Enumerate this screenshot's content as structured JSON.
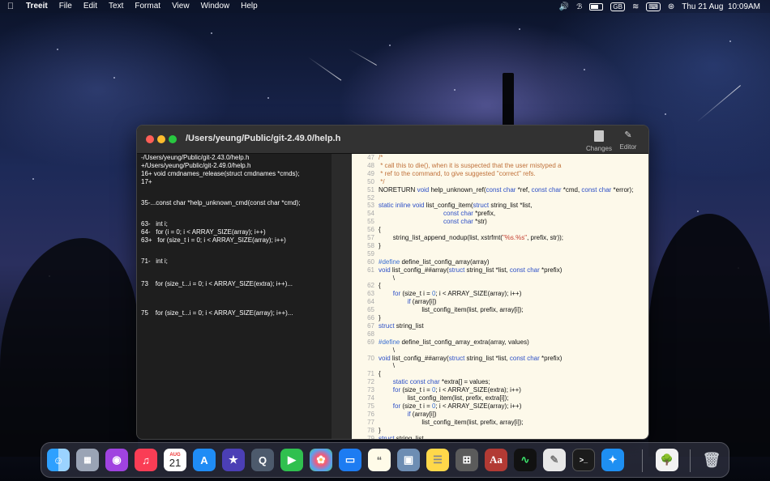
{
  "menubar": {
    "app_name": "Treeit",
    "items": [
      "File",
      "Edit",
      "Text",
      "Format",
      "View",
      "Window",
      "Help"
    ],
    "input_source": "GB",
    "datetime": "Thu 21 Aug  10:09AM"
  },
  "window": {
    "title": "/Users/yeung/Public/git-2.49.0/help.h",
    "toolbar": {
      "changes_label": "Changes",
      "editor_label": "Editor"
    },
    "diff_lines": [
      "-/Users/yeung/Public/git-2.43.0/help.h",
      "+/Users/yeung/Public/git-2.49.0/help.h",
      "16+ void cmdnames_release(struct cmdnames *cmds);",
      "17+",
      "35-...const char *help_unknown_cmd(const char *cmd);",
      "63-   int i;",
      "64-   for (i = 0; i < ARRAY_SIZE(array); i++)",
      "63+   for (size_t i = 0; i < ARRAY_SIZE(array); i++)",
      "71-   int i;",
      "73    for (size_t...i = 0; i < ARRAY_SIZE(extra); i++)...",
      "75    for (size_t...i = 0; i < ARRAY_SIZE(array); i++)..."
    ],
    "code_lines": [
      {
        "n": "47",
        "t": "/*"
      },
      {
        "n": "48",
        "t": " * call this to die(), when it is suspected that the user mistyped a"
      },
      {
        "n": "49",
        "t": " * ref to the command, to give suggested \"correct\" refs."
      },
      {
        "n": "50",
        "t": " */"
      },
      {
        "n": "51",
        "t": "NORETURN void help_unknown_ref(const char *ref, const char *cmd, const char *error);"
      },
      {
        "n": "52",
        "t": ""
      },
      {
        "n": "53",
        "t": "static inline void list_config_item(struct string_list *list,"
      },
      {
        "n": "54",
        "t": "                                    const char *prefix,"
      },
      {
        "n": "55",
        "t": "                                    const char *str)"
      },
      {
        "n": "56",
        "t": "{"
      },
      {
        "n": "57",
        "t": "        string_list_append_nodup(list, xstrfmt(\"%s.%s\", prefix, str));"
      },
      {
        "n": "58",
        "t": "}"
      },
      {
        "n": "59",
        "t": ""
      },
      {
        "n": "60",
        "t": "#define define_list_config_array(array)"
      },
      {
        "n": "61",
        "t": "void list_config_##array(struct string_list *list, const char *prefix)"
      },
      {
        "n": "",
        "t": "        \\"
      },
      {
        "n": "62",
        "t": "{"
      },
      {
        "n": "63",
        "t": "        for (size_t i = 0; i < ARRAY_SIZE(array); i++)"
      },
      {
        "n": "64",
        "t": "                if (array[i])"
      },
      {
        "n": "65",
        "t": "                        list_config_item(list, prefix, array[i]);"
      },
      {
        "n": "66",
        "t": "}"
      },
      {
        "n": "67",
        "t": "struct string_list"
      },
      {
        "n": "68",
        "t": ""
      },
      {
        "n": "69",
        "t": "#define define_list_config_array_extra(array, values)"
      },
      {
        "n": "",
        "t": "        \\"
      },
      {
        "n": "70",
        "t": "void list_config_##array(struct string_list *list, const char *prefix)"
      },
      {
        "n": "",
        "t": "        \\"
      },
      {
        "n": "71",
        "t": "{"
      },
      {
        "n": "72",
        "t": "        static const char *extra[] = values;"
      },
      {
        "n": "73",
        "t": "        for (size_t i = 0; i < ARRAY_SIZE(extra); i++)"
      },
      {
        "n": "74",
        "t": "                list_config_item(list, prefix, extra[i]);"
      },
      {
        "n": "75",
        "t": "        for (size_t i = 0; i < ARRAY_SIZE(array); i++)"
      },
      {
        "n": "76",
        "t": "                if (array[i])"
      },
      {
        "n": "77",
        "t": "                        list_config_item(list, prefix, array[i]);"
      },
      {
        "n": "78",
        "t": "}"
      },
      {
        "n": "79",
        "t": "struct string_list"
      }
    ]
  },
  "dock": {
    "calendar_month": "AUG",
    "calendar_day": "21",
    "dictionary_glyph": "Aa",
    "apps": [
      "finder",
      "launchpad",
      "podcasts",
      "music",
      "calendar",
      "app-store",
      "imovie",
      "quicktime",
      "facetime",
      "photos",
      "keynote",
      "textedit",
      "preview",
      "notes",
      "calculator",
      "dictionary",
      "activity-monitor",
      "script-editor",
      "terminal",
      "safari",
      "treeit",
      "trash"
    ]
  },
  "colors": {
    "editor_bg": "#fdf9ea",
    "keyword": "#2c4fc7",
    "comment": "#c0713a",
    "string": "#c43d2f"
  }
}
